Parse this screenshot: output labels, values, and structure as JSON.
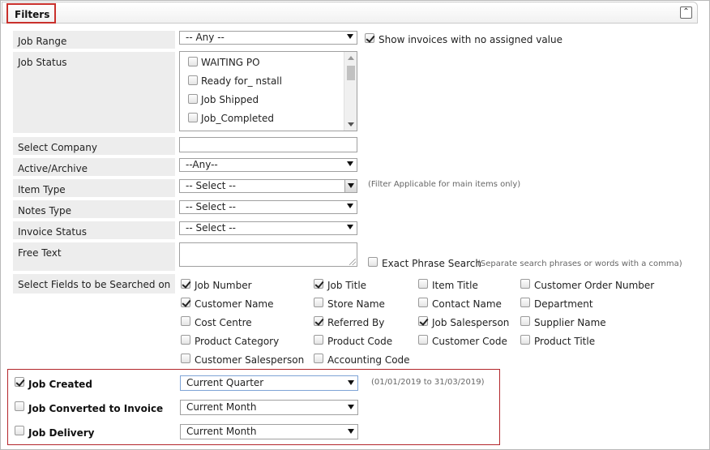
{
  "header": {
    "title": "Filters",
    "collapse_icon": "⌃"
  },
  "job_range": {
    "label": "Job Range",
    "value": "-- Any --",
    "show_no_value_label": "Show invoices with no assigned value",
    "show_no_value_checked": true
  },
  "job_status": {
    "label": "Job Status",
    "options": [
      {
        "label": "WAITING PO",
        "checked": false
      },
      {
        "label": "Ready for_ nstall",
        "checked": false
      },
      {
        "label": "Job Shipped",
        "checked": false
      },
      {
        "label": "Job_Completed",
        "checked": false
      }
    ]
  },
  "select_company": {
    "label": "Select Company",
    "value": ""
  },
  "active_archive": {
    "label": "Active/Archive",
    "value": "--Any--"
  },
  "item_type": {
    "label": "Item Type",
    "value": "-- Select --",
    "note": "(Filter Applicable for main items only)"
  },
  "notes_type": {
    "label": "Notes Type",
    "value": "-- Select --"
  },
  "invoice_status": {
    "label": "Invoice Status",
    "value": "-- Select --"
  },
  "free_text": {
    "label": "Free Text",
    "value": "",
    "exact_phrase_label": "Exact Phrase Search",
    "exact_phrase_checked": false,
    "exact_phrase_note": "(Separate search phrases or words with a comma)"
  },
  "search_fields": {
    "label": "Select Fields to be Searched on",
    "fields": [
      {
        "label": "Job Number",
        "checked": true
      },
      {
        "label": "Job Title",
        "checked": true
      },
      {
        "label": "Item Title",
        "checked": false
      },
      {
        "label": "Customer Order Number",
        "checked": false
      },
      {
        "label": "Customer Name",
        "checked": true
      },
      {
        "label": "Store Name",
        "checked": false
      },
      {
        "label": "Contact Name",
        "checked": false
      },
      {
        "label": "Department",
        "checked": false
      },
      {
        "label": "Cost Centre",
        "checked": false
      },
      {
        "label": "Referred By",
        "checked": true
      },
      {
        "label": "Job Salesperson",
        "checked": true
      },
      {
        "label": "Supplier Name",
        "checked": false
      },
      {
        "label": "Product Category",
        "checked": false
      },
      {
        "label": "Product Code",
        "checked": false
      },
      {
        "label": "Customer Code",
        "checked": false
      },
      {
        "label": "Product Title",
        "checked": false
      },
      {
        "label": "Customer Salesperson",
        "checked": false
      },
      {
        "label": "Accounting Code",
        "checked": false
      }
    ]
  },
  "date_filters": {
    "job_created": {
      "label": "Job Created",
      "checked": true,
      "value": "Current Quarter",
      "range": "(01/01/2019 to 31/03/2019)"
    },
    "job_converted": {
      "label": "Job Converted to Invoice",
      "checked": false,
      "value": "Current Month"
    },
    "job_delivery": {
      "label": "Job Delivery",
      "checked": false,
      "value": "Current Month"
    }
  },
  "colors": {
    "highlight_border": "#b3262b",
    "label_bg": "#ededed"
  }
}
